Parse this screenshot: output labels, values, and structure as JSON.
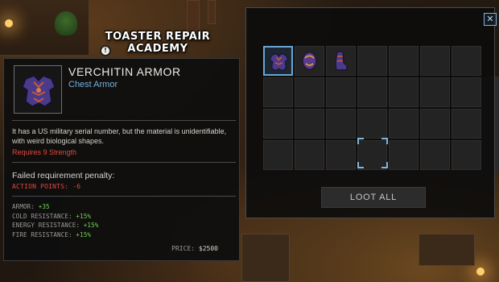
{
  "location": {
    "title": "TOASTER REPAIR ACADEMY"
  },
  "tooltip": {
    "item_name": "VERCHITIN ARMOR",
    "item_type": "Chest Armor",
    "description": "It has a US military serial number, but the material is unidentifiable, with weird biological shapes.",
    "requirement": "Requires 9 Strength",
    "penalty_title": "Failed requirement penalty:",
    "penalty_label": "ACTION POINTS:",
    "penalty_value": "-6",
    "stats": [
      {
        "label": "ARMOR:",
        "value": "+35"
      },
      {
        "label": "COLD RESISTANCE:",
        "value": "+15%"
      },
      {
        "label": "ENERGY RESISTANCE:",
        "value": "+15%"
      },
      {
        "label": "FIRE RESISTANCE:",
        "value": "+15%"
      }
    ],
    "price_label": "PRICE:",
    "price_value": "$2500"
  },
  "loot": {
    "close_icon": "close-icon",
    "loot_all_label": "LOOT ALL",
    "grid": {
      "columns": 7,
      "rows": 4
    },
    "items": [
      {
        "slot": 0,
        "icon": "verchitin-armor-icon",
        "selected": true
      },
      {
        "slot": 1,
        "icon": "verchitin-helmet-icon",
        "selected": false
      },
      {
        "slot": 2,
        "icon": "verchitin-boots-icon",
        "selected": false
      }
    ]
  },
  "colors": {
    "item_type": "#6fb1e0",
    "requirement": "#e0473f",
    "stat_value": "#6fd453",
    "selection": "#6aa6d6"
  }
}
